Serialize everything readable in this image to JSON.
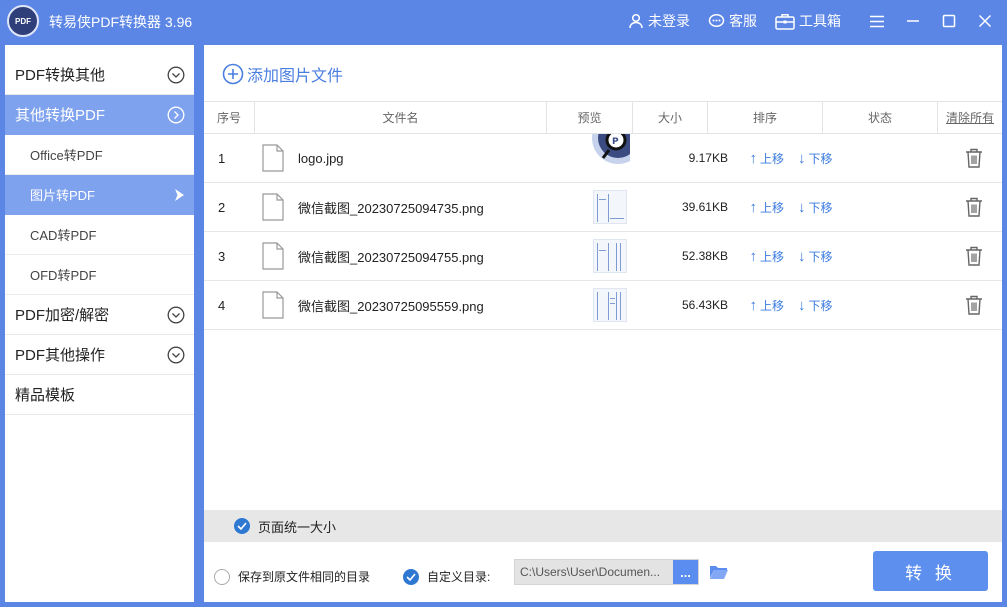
{
  "app": {
    "title": "转易侠PDF转换器 3.96",
    "logo_text": "PDF"
  },
  "titlebar": {
    "login": "未登录",
    "service": "客服",
    "toolbox": "工具箱"
  },
  "sidebar": {
    "cat_pdf_to_other": "PDF转换其他",
    "cat_other_to_pdf": "其他转换PDF",
    "sub_office": "Office转PDF",
    "sub_image": "图片转PDF",
    "sub_cad": "CAD转PDF",
    "sub_ofd": "OFD转PDF",
    "cat_encrypt": "PDF加密/解密",
    "cat_other_ops": "PDF其他操作",
    "cat_templates": "精品模板"
  },
  "main": {
    "add_file": "添加图片文件",
    "columns": {
      "index": "序号",
      "filename": "文件名",
      "preview": "预览",
      "size": "大小",
      "sort": "排序",
      "status": "状态",
      "clear_all": "清除所有"
    },
    "sort_up": "上移",
    "sort_down": "下移",
    "files": [
      {
        "index": "1",
        "name": "logo.jpg",
        "size": "9.17KB"
      },
      {
        "index": "2",
        "name": "微信截图_20230725094735.png",
        "size": "39.61KB"
      },
      {
        "index": "3",
        "name": "微信截图_20230725094755.png",
        "size": "52.38KB"
      },
      {
        "index": "4",
        "name": "微信截图_20230725095559.png",
        "size": "56.43KB"
      }
    ],
    "uniform_size": "页面统一大小",
    "save_same_dir": "保存到原文件相同的目录",
    "custom_dir": "自定义目录:",
    "custom_dir_path": "C:\\Users\\User\\Documen...",
    "browse_label": "...",
    "convert": "转 换"
  },
  "colors": {
    "brand": "#5b86e5",
    "sidebar_active": "#7fa2ee",
    "link": "#3a7be0",
    "convert_button": "#5d8fef"
  }
}
